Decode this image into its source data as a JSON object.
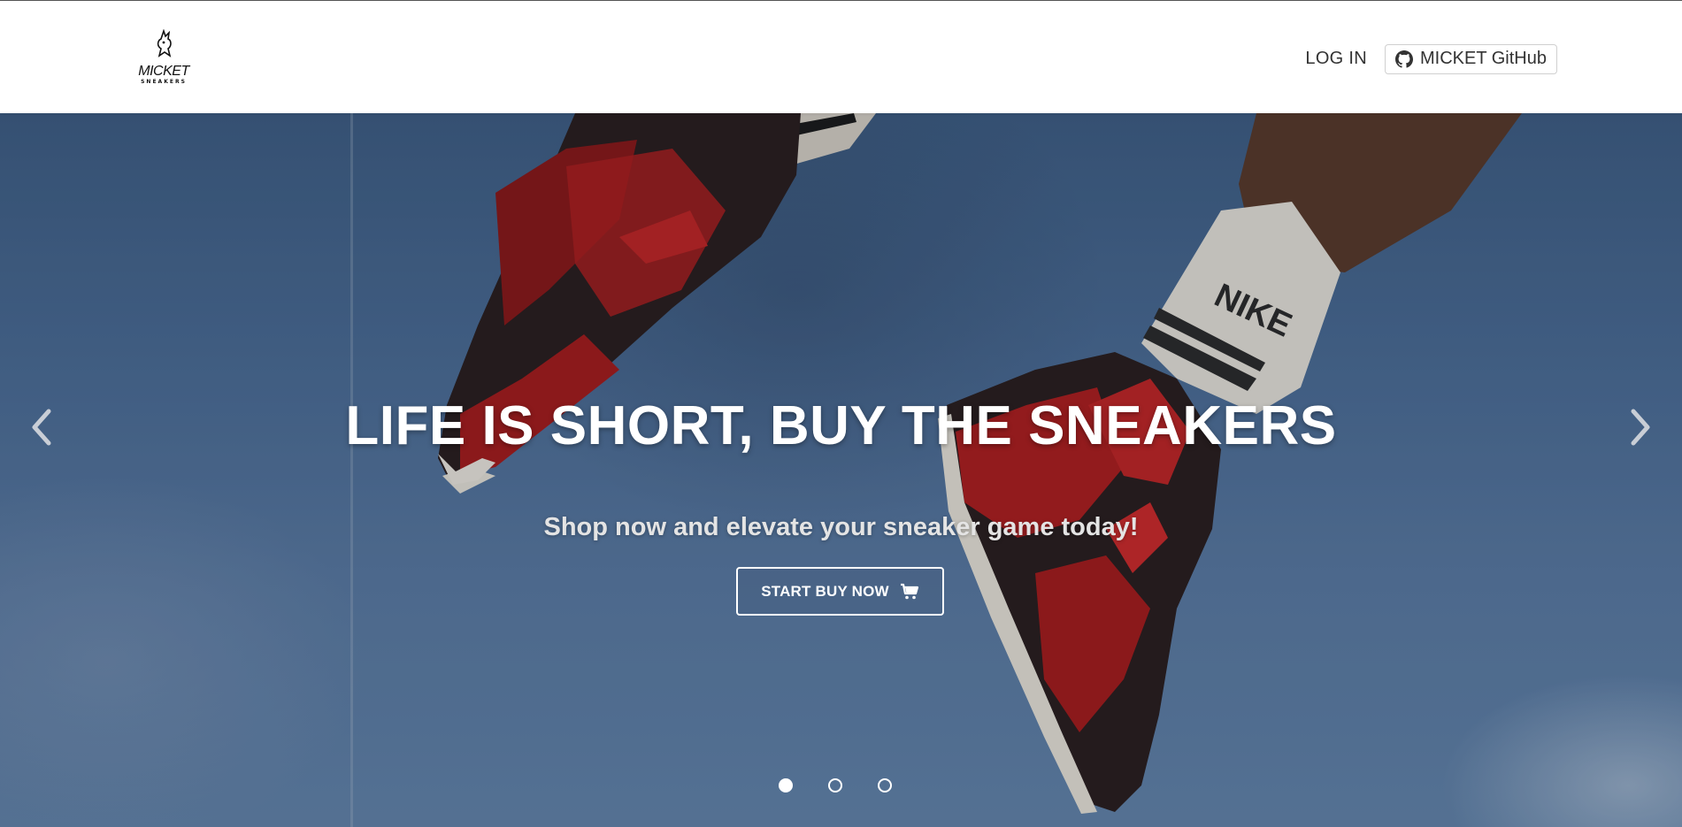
{
  "navbar": {
    "logo": {
      "brand": "MICKET",
      "subtitle": "SNEAKERS",
      "icon": "rabbit-logo-icon"
    },
    "login_label": "LOG IN",
    "github": {
      "label": "MICKET GitHub",
      "icon": "github-icon"
    }
  },
  "hero": {
    "title": "LIFE IS SHORT, BUY THE SNEAKERS",
    "subtitle": "Shop now and elevate your sneaker game today!",
    "cta": {
      "label": "START BUY NOW",
      "icon": "shopping-cart-icon"
    },
    "prev_icon": "chevron-left-icon",
    "next_icon": "chevron-right-icon",
    "slides": [
      {
        "active": true
      },
      {
        "active": false
      },
      {
        "active": false
      }
    ]
  },
  "colors": {
    "sky": "#4c6e98",
    "shoe_red": "#b01e1e",
    "shoe_black": "#2a1e1e",
    "text_white": "#ffffff",
    "nav_text": "#333333"
  }
}
